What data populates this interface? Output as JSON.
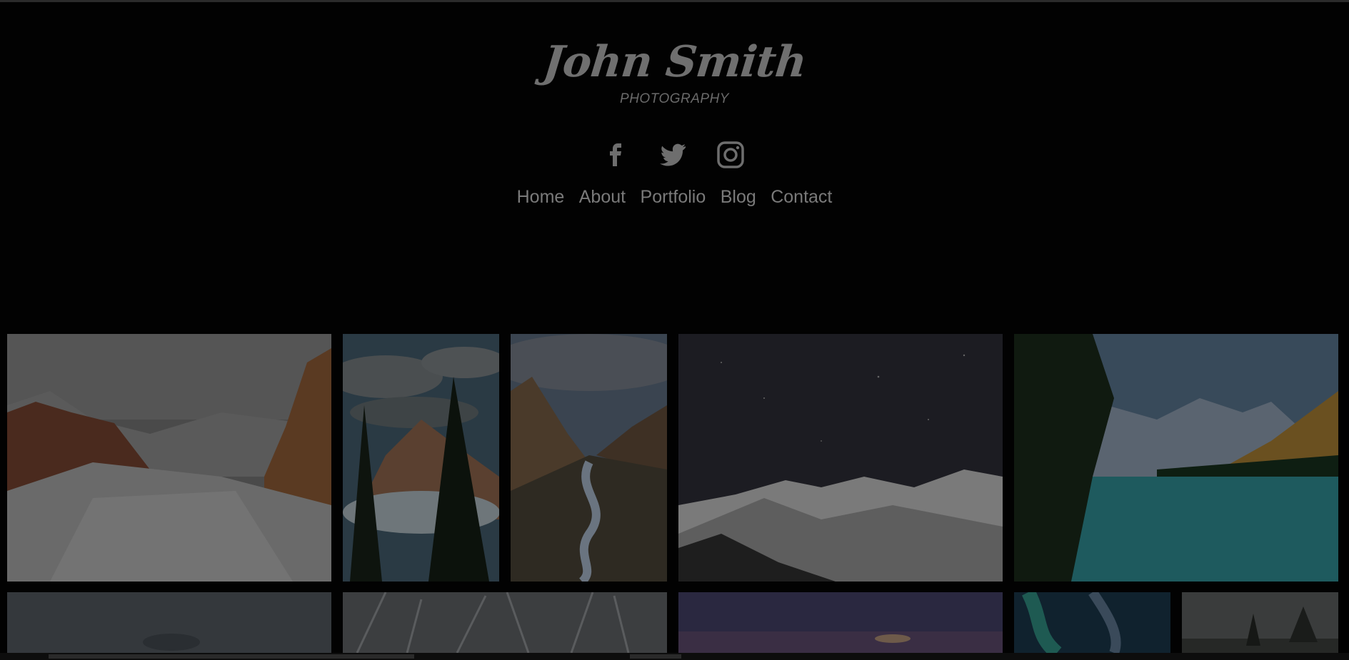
{
  "site": {
    "name": "John Smith",
    "tagline": "PHOTOGRAPHY"
  },
  "social": [
    {
      "name": "facebook-icon"
    },
    {
      "name": "twitter-icon"
    },
    {
      "name": "instagram-icon"
    }
  ],
  "nav": {
    "home": "Home",
    "about": "About",
    "portfolio": "Portfolio",
    "blog": "Blog",
    "contact": "Contact"
  },
  "colors": {
    "background": "#020202",
    "text": "#7a7a7a"
  },
  "gallery": [
    {
      "name": "photo-canyon-snow"
    },
    {
      "name": "photo-pines-mountain"
    },
    {
      "name": "photo-valley-river"
    },
    {
      "name": "photo-starry-snow-peaks"
    },
    {
      "name": "photo-turquoise-lake"
    },
    {
      "name": "photo-cloudy-sky"
    },
    {
      "name": "photo-snowy-trees"
    },
    {
      "name": "photo-purple-dusk"
    },
    {
      "name": "photo-aurora"
    },
    {
      "name": "photo-misty-forest"
    }
  ]
}
